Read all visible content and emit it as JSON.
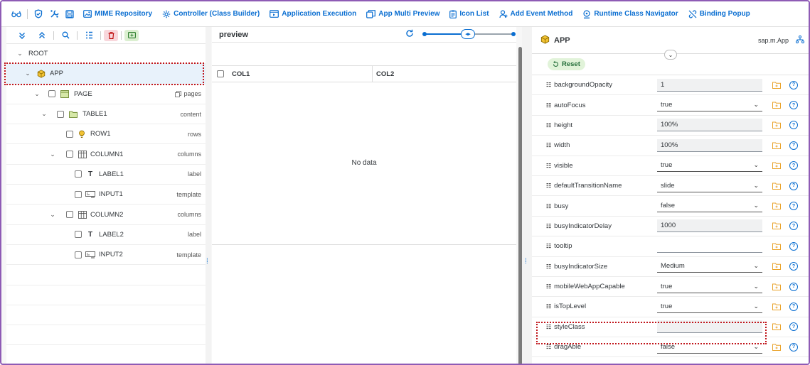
{
  "toolbar": {
    "buttons": [
      {
        "label": "MIME Repository"
      },
      {
        "label": "Controller (Class Builder)"
      },
      {
        "label": "Application Execution"
      },
      {
        "label": "App Multi Preview"
      },
      {
        "label": "Icon List"
      },
      {
        "label": "Add Event Method"
      },
      {
        "label": "Runtime Class Navigator"
      },
      {
        "label": "Binding Popup"
      }
    ]
  },
  "tree": {
    "rows": [
      {
        "label": "ROOT",
        "agg": ""
      },
      {
        "label": "APP",
        "agg": ""
      },
      {
        "label": "PAGE",
        "agg": "pages"
      },
      {
        "label": "TABLE1",
        "agg": "content"
      },
      {
        "label": "ROW1",
        "agg": "rows"
      },
      {
        "label": "COLUMN1",
        "agg": "columns"
      },
      {
        "label": "LABEL1",
        "agg": "label"
      },
      {
        "label": "INPUT1",
        "agg": "template"
      },
      {
        "label": "COLUMN2",
        "agg": "columns"
      },
      {
        "label": "LABEL2",
        "agg": "label"
      },
      {
        "label": "INPUT2",
        "agg": "template"
      }
    ]
  },
  "preview": {
    "title": "preview",
    "col1": "COL1",
    "col2": "COL2",
    "no_data": "No data"
  },
  "properties": {
    "title": "APP",
    "class_name": "sap.m.App",
    "reset_label": "Reset",
    "rows": [
      {
        "name": "backgroundOpacity",
        "value": "1"
      },
      {
        "name": "autoFocus",
        "value": "true"
      },
      {
        "name": "height",
        "value": "100%"
      },
      {
        "name": "width",
        "value": "100%"
      },
      {
        "name": "visible",
        "value": "true"
      },
      {
        "name": "defaultTransitionName",
        "value": "slide"
      },
      {
        "name": "busy",
        "value": "false"
      },
      {
        "name": "busyIndicatorDelay",
        "value": "1000"
      },
      {
        "name": "tooltip",
        "value": ""
      },
      {
        "name": "busyIndicatorSize",
        "value": "Medium"
      },
      {
        "name": "mobileWebAppCapable",
        "value": "true"
      },
      {
        "name": "isTopLevel",
        "value": "true"
      },
      {
        "name": "styleClass",
        "value": ""
      },
      {
        "name": "dragAble",
        "value": "false"
      }
    ]
  },
  "colors": {
    "accent": "#0a6ed1",
    "highlight": "#c0151b",
    "frame": "#8e5bb5"
  }
}
